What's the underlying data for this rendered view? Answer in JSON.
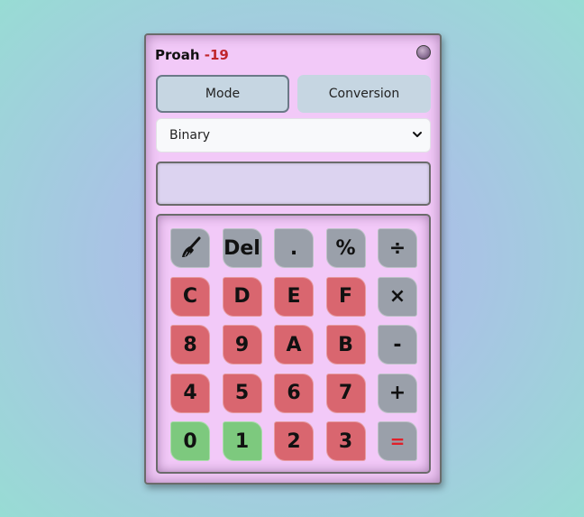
{
  "header": {
    "name": "Proah",
    "number": "-19"
  },
  "controls": {
    "mode_label": "Mode",
    "conversion_label": "Conversion"
  },
  "base_select": {
    "selected": "Binary"
  },
  "display": {
    "value": ""
  },
  "keys": [
    {
      "label": "",
      "icon": "broom-icon",
      "color": "gray"
    },
    {
      "label": "Del",
      "color": "gray"
    },
    {
      "label": ".",
      "color": "gray"
    },
    {
      "label": "%",
      "color": "gray"
    },
    {
      "label": "÷",
      "color": "gray"
    },
    {
      "label": "C",
      "color": "red"
    },
    {
      "label": "D",
      "color": "red"
    },
    {
      "label": "E",
      "color": "red"
    },
    {
      "label": "F",
      "color": "red"
    },
    {
      "label": "×",
      "color": "gray"
    },
    {
      "label": "8",
      "color": "red"
    },
    {
      "label": "9",
      "color": "red"
    },
    {
      "label": "A",
      "color": "red"
    },
    {
      "label": "B",
      "color": "red"
    },
    {
      "label": "-",
      "color": "gray"
    },
    {
      "label": "4",
      "color": "red"
    },
    {
      "label": "5",
      "color": "red"
    },
    {
      "label": "6",
      "color": "red"
    },
    {
      "label": "7",
      "color": "red"
    },
    {
      "label": "+",
      "color": "gray"
    },
    {
      "label": "0",
      "color": "green"
    },
    {
      "label": "1",
      "color": "green"
    },
    {
      "label": "2",
      "color": "red"
    },
    {
      "label": "3",
      "color": "red"
    },
    {
      "label": "=",
      "color": "gray",
      "accent": "#e0202a"
    }
  ],
  "colors": {
    "panel": "#f2c9f8",
    "key_gray": "#9aa0aa",
    "key_red": "#d9666f",
    "key_green": "#7dc97e",
    "title_number": "#c0262d"
  }
}
